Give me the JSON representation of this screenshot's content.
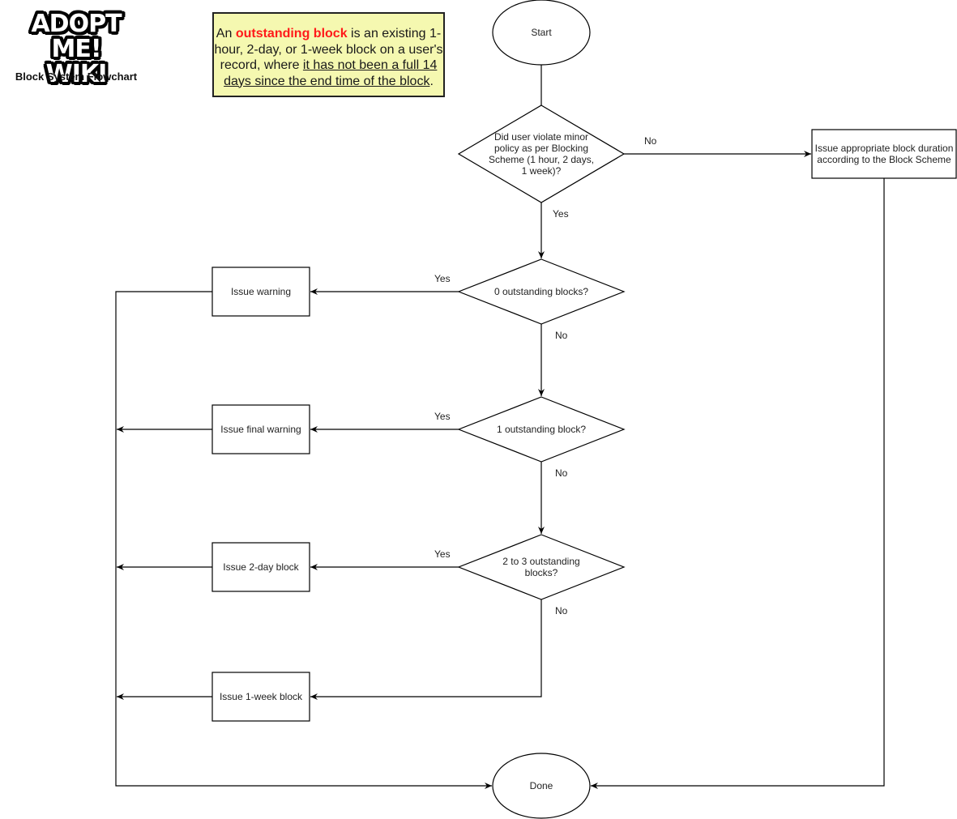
{
  "header": {
    "logo_line1": "ADOPT ME!",
    "logo_line2": "WIKI",
    "subtitle": "Block System Flowchart"
  },
  "note": {
    "prefix": "An ",
    "highlight": "outstanding block",
    "middle": " is an existing 1-hour, 2-day, or 1-week block on a user's record, where ",
    "underlined": "it has not been a full 14 days since the end time of the block",
    "suffix": ".",
    "highlight_color": "#ff1a1a",
    "background_color": "#f5f8b0"
  },
  "nodes": {
    "start": "Start",
    "decision_minor_policy": "Did user violate minor policy as per Blocking Scheme (1 hour, 2 days, 1 week)?",
    "issue_appropriate": "Issue appropriate block duration according to the Block Scheme",
    "decision_0_blocks": "0 outstanding blocks?",
    "decision_1_block": "1 outstanding block?",
    "decision_2_3_blocks": "2 to 3 outstanding blocks?",
    "issue_warning": "Issue warning",
    "issue_final_warning": "Issue final warning",
    "issue_2day_block": "Issue 2-day block",
    "issue_1week_block": "Issue 1-week block",
    "done": "Done"
  },
  "edge_labels": {
    "minor_no": "No",
    "minor_yes": "Yes",
    "zero_yes": "Yes",
    "zero_no": "No",
    "one_yes": "Yes",
    "one_no": "No",
    "two_three_yes": "Yes",
    "two_three_no": "No"
  }
}
